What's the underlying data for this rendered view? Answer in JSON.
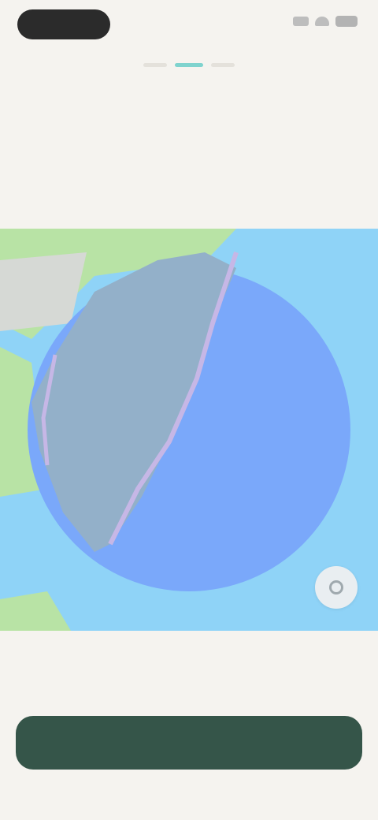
{
  "status_bar": {
    "time": "",
    "icons": [
      "signal-icon",
      "wifi-icon",
      "battery-icon"
    ]
  },
  "progress": {
    "total_steps": 3,
    "current_step": 2
  },
  "header": {
    "title": "",
    "subtitle": ""
  },
  "map": {
    "recenter_icon": "location-icon"
  },
  "slider": {
    "min_label": "",
    "max_label": "",
    "value_text": ""
  },
  "footer": {
    "continue_label": ""
  },
  "colors": {
    "background": "#F5F3EF",
    "water": "#8FD3F7",
    "land_green": "#B8E3A5",
    "radius_fill": "#7AA8FA",
    "road": "#C6B7E6",
    "primary_button": "#355549",
    "progress_active": "#7FD3CE"
  }
}
